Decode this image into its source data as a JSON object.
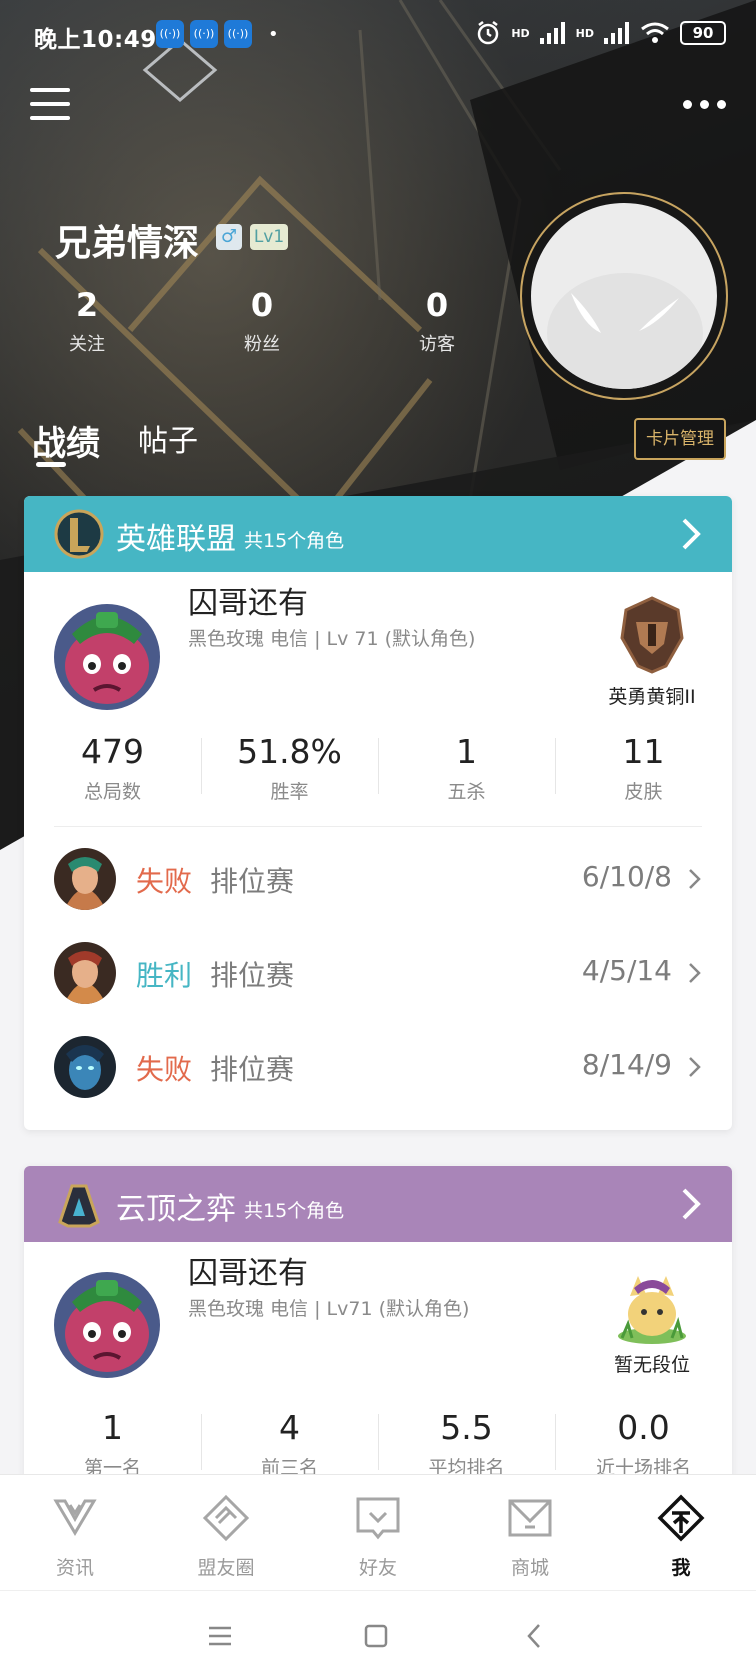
{
  "status_bar": {
    "time": "晚上10:49",
    "app_icons": [
      "hd-icon",
      "hd-icon",
      "hd-icon"
    ],
    "dot": "•",
    "hd1": "HD",
    "hd2": "HD",
    "battery": "90"
  },
  "profile": {
    "nickname": "兄弟情深",
    "gender": "♂",
    "level": "Lv1",
    "counters": [
      {
        "value": "2",
        "label": "关注"
      },
      {
        "value": "0",
        "label": "粉丝"
      },
      {
        "value": "0",
        "label": "访客"
      }
    ]
  },
  "tabs": {
    "battle": "战绩",
    "posts": "帖子",
    "card_manage": "卡片管理"
  },
  "lol": {
    "game_name": "英雄联盟",
    "role_count": "共15个角色",
    "player_name": "囚哥还有",
    "player_sub": "黑色玫瑰 电信 | Lv 71 (默认角色)",
    "rank": "英勇黄铜II",
    "stats": [
      {
        "value": "479",
        "label": "总局数"
      },
      {
        "value": "51.8%",
        "label": "胜率"
      },
      {
        "value": "1",
        "label": "五杀"
      },
      {
        "value": "11",
        "label": "皮肤"
      }
    ],
    "matches": [
      {
        "result": "失败",
        "mode": "排位赛",
        "kda": "6/10/8",
        "outcome": "lose"
      },
      {
        "result": "胜利",
        "mode": "排位赛",
        "kda": "4/5/14",
        "outcome": "win"
      },
      {
        "result": "失败",
        "mode": "排位赛",
        "kda": "8/14/9",
        "outcome": "lose"
      }
    ]
  },
  "tft": {
    "game_name": "云顶之弈",
    "role_count": "共15个角色",
    "player_name": "囚哥还有",
    "player_sub": "黑色玫瑰 电信 | Lv71 (默认角色)",
    "rank": "暂无段位",
    "stats": [
      {
        "value": "1",
        "label": "第一名"
      },
      {
        "value": "4",
        "label": "前三名"
      },
      {
        "value": "5.5",
        "label": "平均排名"
      },
      {
        "value": "0.0",
        "label": "近十场排名"
      }
    ]
  },
  "bottom_nav": [
    {
      "label": "资讯",
      "icon": "news-icon"
    },
    {
      "label": "盟友圈",
      "icon": "friends-circle-icon"
    },
    {
      "label": "好友",
      "icon": "friends-icon"
    },
    {
      "label": "商城",
      "icon": "store-icon"
    },
    {
      "label": "我",
      "icon": "me-icon",
      "active": true
    }
  ],
  "colors": {
    "lol_header": "#46b6c4",
    "tft_header": "#a985b8",
    "lose": "#e26a4c",
    "win": "#46b6c4",
    "gold": "#c8a45c"
  }
}
